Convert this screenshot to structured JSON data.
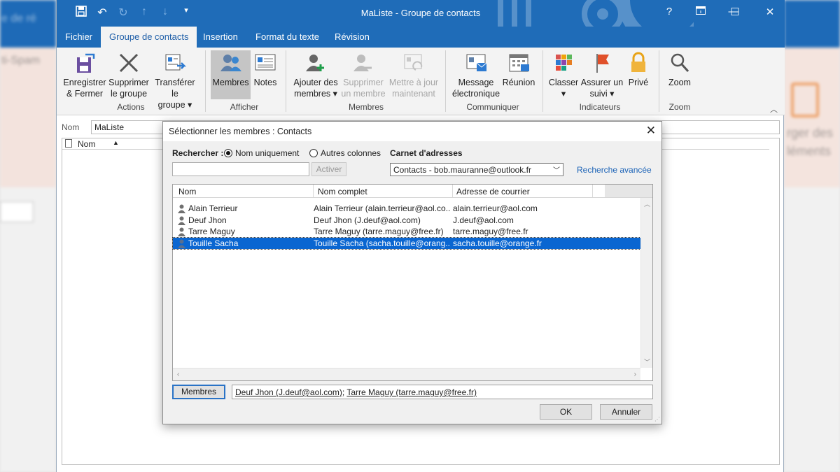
{
  "window": {
    "title": "MaListe  -  Groupe de contacts",
    "help": "?",
    "restore_icon": "ribbon-display-icon",
    "minimize": "—",
    "maximize": "☐",
    "close": "✕"
  },
  "tabs": [
    {
      "label": "Fichier"
    },
    {
      "label": "Groupe de contacts"
    },
    {
      "label": "Insertion"
    },
    {
      "label": "Format du texte"
    },
    {
      "label": "Révision"
    }
  ],
  "ribbon": {
    "actions": {
      "save_close": [
        "Enregistrer",
        "& Fermer"
      ],
      "delete_group": [
        "Supprimer",
        "le groupe"
      ],
      "forward_group": [
        "Transférer le",
        "groupe ▾"
      ],
      "group_label": "Actions"
    },
    "afficher": {
      "members": "Membres",
      "notes": "Notes",
      "group_label": "Afficher"
    },
    "membres": {
      "add": [
        "Ajouter des",
        "membres ▾"
      ],
      "remove": [
        "Supprimer",
        "un membre"
      ],
      "update": [
        "Mettre à jour",
        "maintenant"
      ],
      "group_label": "Membres"
    },
    "communiquer": {
      "email": [
        "Message",
        "électronique"
      ],
      "meeting": "Réunion",
      "group_label": "Communiquer"
    },
    "indicateurs": {
      "categorize": [
        "Classer",
        "▾"
      ],
      "followup": [
        "Assurer un",
        "suivi ▾"
      ],
      "private": "Privé",
      "group_label": "Indicateurs"
    },
    "zoom": {
      "zoom": "Zoom",
      "group_label": "Zoom"
    }
  },
  "form": {
    "nom_label": "Nom",
    "nom_value": "MaListe",
    "list_header": "Nom"
  },
  "dialog": {
    "title": "Sélectionner les membres : Contacts",
    "search_label": "Rechercher :",
    "radio_name_only": "Nom uniquement",
    "radio_other_columns": "Autres colonnes",
    "address_book_label": "Carnet d'adresses",
    "search_value": "",
    "activate_button": "Activer",
    "address_book_value": "Contacts - bob.mauranne@outlook.fr",
    "advanced_search": "Recherche avancée",
    "columns": [
      "Nom",
      "Nom complet",
      "Adresse de courrier"
    ],
    "rows": [
      {
        "name": "Alain Terrieur",
        "full": "Alain Terrieur (alain.terrieur@aol.co...",
        "email": "alain.terrieur@aol.com",
        "selected": false
      },
      {
        "name": "Deuf Jhon",
        "full": "Deuf Jhon (J.deuf@aol.com)",
        "email": "J.deuf@aol.com",
        "selected": false
      },
      {
        "name": "Tarre Maguy",
        "full": "Tarre Maguy (tarre.maguy@free.fr)",
        "email": "tarre.maguy@free.fr",
        "selected": false
      },
      {
        "name": "Touille Sacha",
        "full": "Touille Sacha (sacha.touille@orang...",
        "email": "sacha.touille@orange.fr",
        "selected": true
      }
    ],
    "members_button": "Membres",
    "members_value_1": "Deuf Jhon (J.deuf@aol.com)",
    "members_sep": "; ",
    "members_value_2": "Tarre Maguy (tarre.maguy@free.fr)",
    "ok_button": "OK",
    "cancel_button": "Annuler"
  },
  "colors": {
    "titlebar": "#1f6cb8",
    "selection": "#0a66d1",
    "link": "#1c63b7"
  }
}
